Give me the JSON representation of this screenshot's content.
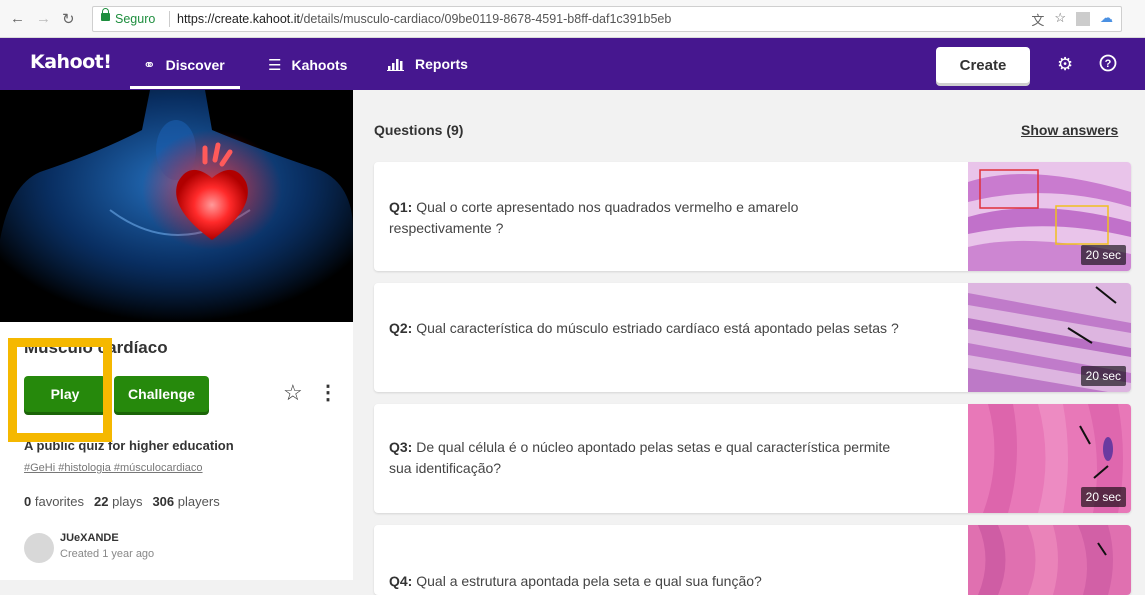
{
  "browser": {
    "secure_label": "Seguro",
    "url_host": "https://create.kahoot.it",
    "url_path": "/details/musculo-cardiaco/09be0119-8678-4591-b8ff-daf1c391b5eb"
  },
  "nav": {
    "logo": "Kahoot!",
    "discover": "Discover",
    "kahoots": "Kahoots",
    "reports": "Reports",
    "create": "Create"
  },
  "quiz": {
    "title": "Músculo cardíaco",
    "play": "Play",
    "challenge": "Challenge",
    "description": "A public quiz for higher education",
    "tags": "#GeHi #histologia #músculocardiaco",
    "favorites_count": "0",
    "favorites_label": "favorites",
    "plays_count": "22",
    "plays_label": "plays",
    "players_count": "306",
    "players_label": "players",
    "author": "JUeXANDE",
    "created": "Created 1 year ago"
  },
  "questions": {
    "heading": "Questions (9)",
    "show_answers": "Show answers",
    "items": [
      {
        "num": "Q1:",
        "text": "Qual o corte apresentado nos quadrados vermelho e amarelo respectivamente ?",
        "time": "20 sec"
      },
      {
        "num": "Q2:",
        "text": "Qual característica do músculo estriado cardíaco está apontado pelas setas ?",
        "time": "20 sec"
      },
      {
        "num": "Q3:",
        "text": "De qual célula é o núcleo apontado pelas setas e qual característica permite sua identificação?",
        "time": "20 sec"
      },
      {
        "num": "Q4:",
        "text": "Qual a estrutura apontada pela seta e qual sua função?"
      }
    ]
  },
  "colors": {
    "brand": "#46178f",
    "play_green": "#26890c",
    "highlight": "#f5b800"
  }
}
